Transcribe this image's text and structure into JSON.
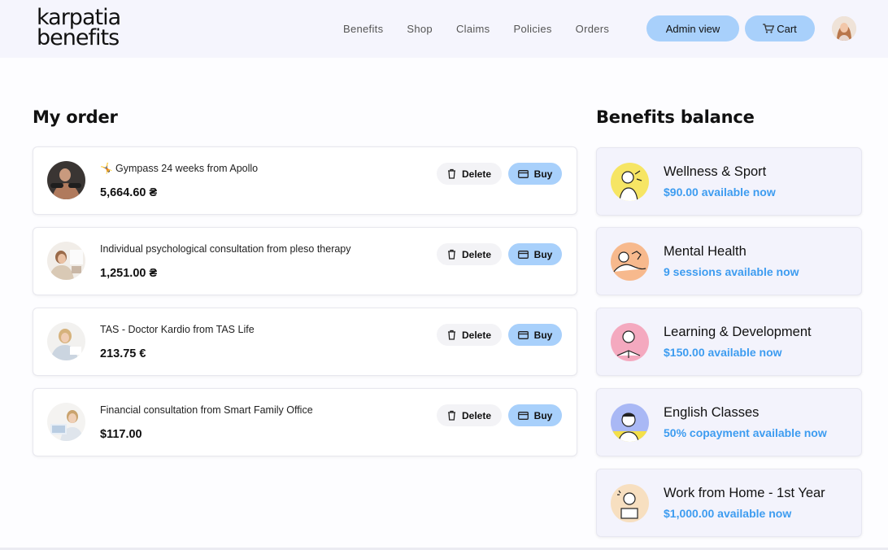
{
  "header": {
    "logo_line1": "karpatia",
    "logo_line2": "benefits",
    "nav": [
      "Benefits",
      "Shop",
      "Claims",
      "Policies",
      "Orders"
    ],
    "admin_label": "Admin view",
    "cart_label": "Cart"
  },
  "order": {
    "title": "My order",
    "delete_label": "Delete",
    "buy_label": "Buy",
    "items": [
      {
        "name": "🤸 Gympass 24 weeks from Apollo",
        "price": "5,664.60 ₴"
      },
      {
        "name": "Individual psychological consultation from pleso therapy",
        "price": "1,251.00 ₴"
      },
      {
        "name": "TAS - Doctor Kardio from TAS Life",
        "price": "213.75 €"
      },
      {
        "name": "Financial consultation from Smart Family Office",
        "price": "$117.00"
      }
    ]
  },
  "balance": {
    "title": "Benefits balance",
    "items": [
      {
        "title": "Wellness & Sport",
        "sub": "$90.00 available now"
      },
      {
        "title": "Mental Health",
        "sub": "9 sessions available now"
      },
      {
        "title": "Learning & Development",
        "sub": "$150.00 available now"
      },
      {
        "title": "English Classes",
        "sub": "50% copayment available now"
      },
      {
        "title": "Work from Home - 1st Year",
        "sub": "$1,000.00 available now"
      }
    ]
  },
  "colors": {
    "accent": "#a8d0fb",
    "link": "#3d9cf0",
    "header_bg": "#f5f5fd"
  }
}
